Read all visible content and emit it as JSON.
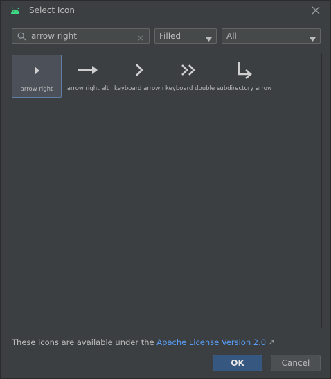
{
  "dialog": {
    "title": "Select Icon",
    "app_icon": "android-icon",
    "close_icon": "close-icon"
  },
  "search": {
    "value": "arrow right",
    "placeholder": ""
  },
  "filters": {
    "style": "Filled",
    "category": "All"
  },
  "icons": [
    {
      "label": "arrow right",
      "glyph": "arrow-right-icon",
      "selected": true
    },
    {
      "label": "arrow right alt",
      "glyph": "arrow-right-alt-icon",
      "selected": false
    },
    {
      "label": "keyboard arrow rig",
      "glyph": "keyboard-arrow-right-icon",
      "selected": false
    },
    {
      "label": "keyboard double a",
      "glyph": "keyboard-double-arrow-right-icon",
      "selected": false
    },
    {
      "label": "subdirectory arrow",
      "glyph": "subdirectory-arrow-right-icon",
      "selected": false
    }
  ],
  "footer": {
    "license_prefix": "These icons are available under the ",
    "license_link": "Apache License Version 2.0",
    "ok_label": "OK",
    "cancel_label": "Cancel"
  },
  "colors": {
    "background": "#3c3f41",
    "accent": "#365880",
    "link": "#589df6",
    "android_green": "#3ddc84"
  }
}
